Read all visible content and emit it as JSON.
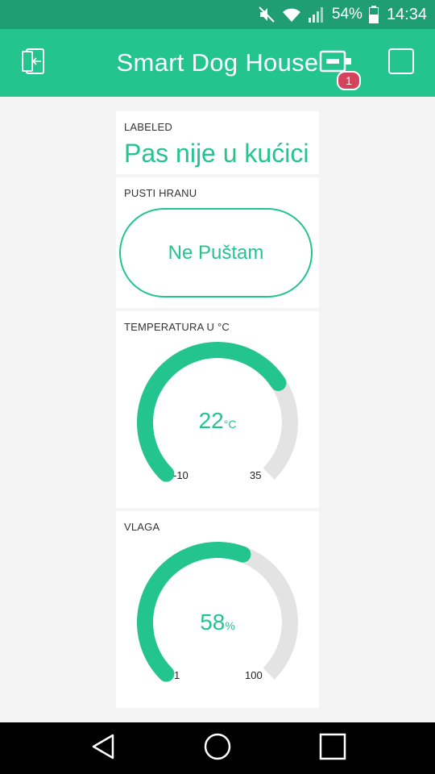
{
  "status_bar": {
    "battery": "54%",
    "time": "14:34",
    "icons": [
      "mute-icon",
      "wifi-icon",
      "signal-icon",
      "battery-icon"
    ]
  },
  "app_bar": {
    "title": "Smart Dog House",
    "device_badge": "1",
    "icons": [
      "exit-icon",
      "device-icon",
      "stop-square-icon"
    ]
  },
  "widgets": {
    "labeled": {
      "label": "LABELED",
      "value": "Pas nije u kućici"
    },
    "button": {
      "label": "PUSTI HRANU",
      "text": "Ne Puštam"
    },
    "temperature": {
      "label": "TEMPERATURA U °C",
      "value": "22",
      "unit": "°C",
      "min": "-10",
      "max": "35",
      "min_num": -10,
      "max_num": 35,
      "value_num": 22
    },
    "humidity": {
      "label": "VLAGA",
      "value": "58",
      "unit": "%",
      "min": "1",
      "max": "100",
      "min_num": 1,
      "max_num": 100,
      "value_num": 58
    }
  },
  "colors": {
    "accent": "#23c48e",
    "status_bar": "#1f9e73",
    "badge": "#d3435c",
    "gauge_track": "#e3e3e3"
  },
  "nav_bar": {
    "icons": [
      "back-icon",
      "home-icon",
      "recents-icon"
    ]
  }
}
